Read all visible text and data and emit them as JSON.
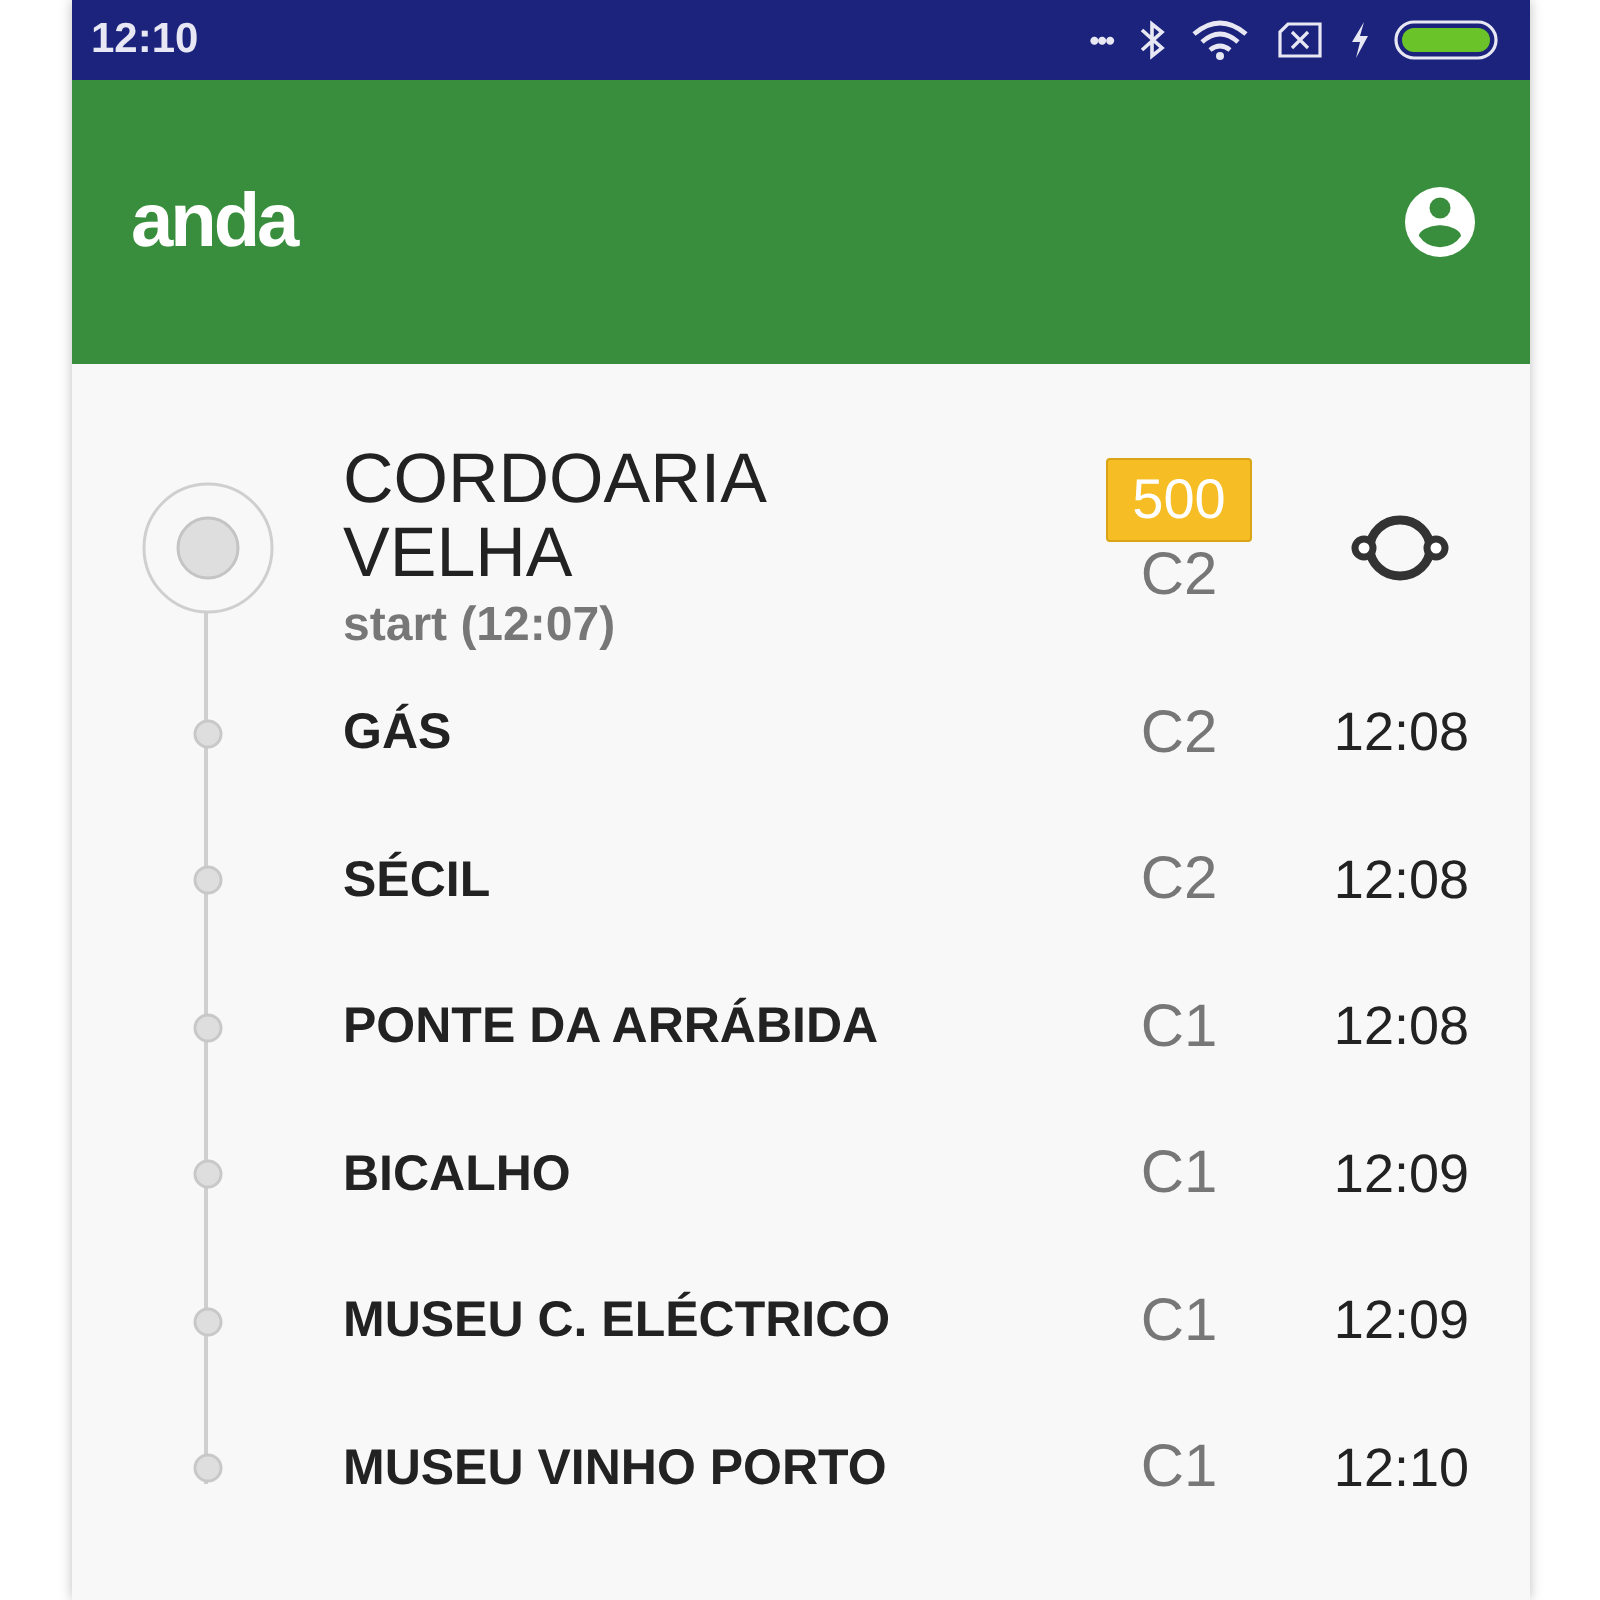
{
  "status_bar": {
    "time": "12:10",
    "more": "•••"
  },
  "app_bar": {
    "logo": "anda"
  },
  "origin": {
    "name": "CORDOARIA VELHA",
    "subtitle": "start (12:07)",
    "line": "500",
    "zone": "C2"
  },
  "stops": [
    {
      "name": "GÁS",
      "zone": "C2",
      "time": "12:08"
    },
    {
      "name": "SÉCIL",
      "zone": "C2",
      "time": "12:08"
    },
    {
      "name": "PONTE DA ARRÁBIDA",
      "zone": "C1",
      "time": "12:08"
    },
    {
      "name": "BICALHO",
      "zone": "C1",
      "time": "12:09"
    },
    {
      "name": "MUSEU C. ELÉCTRICO",
      "zone": "C1",
      "time": "12:09"
    },
    {
      "name": "MUSEU VINHO PORTO",
      "zone": "C1",
      "time": "12:10"
    }
  ]
}
